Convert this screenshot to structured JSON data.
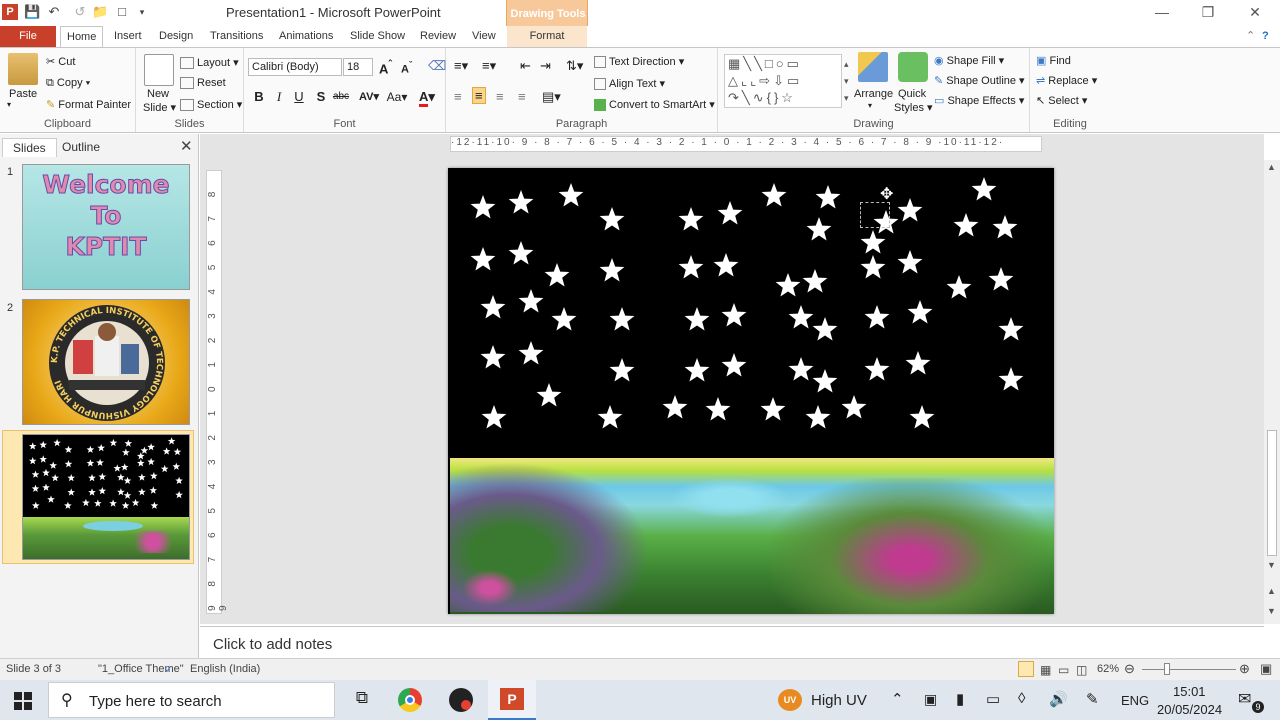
{
  "titlebar": {
    "title": "Presentation1  -  Microsoft PowerPoint",
    "context_tools": "Drawing Tools",
    "context_tab": "Format"
  },
  "tabs": {
    "file": "File",
    "items": [
      "Home",
      "Insert",
      "Design",
      "Transitions",
      "Animations",
      "Slide Show",
      "Review",
      "View"
    ]
  },
  "ribbon": {
    "clipboard": {
      "paste": "Paste",
      "cut": "Cut",
      "copy": "Copy",
      "format_painter": "Format Painter",
      "label": "Clipboard"
    },
    "slides": {
      "new_slide_1": "New",
      "new_slide_2": "Slide",
      "layout": "Layout",
      "reset": "Reset",
      "section": "Section",
      "label": "Slides"
    },
    "font": {
      "name": "Calibri (Body)",
      "size": "18",
      "label": "Font"
    },
    "paragraph": {
      "text_direction": "Text Direction",
      "align_text": "Align Text",
      "smartart": "Convert to SmartArt",
      "label": "Paragraph"
    },
    "drawing": {
      "arrange": "Arrange",
      "quick_styles_1": "Quick",
      "quick_styles_2": "Styles",
      "shape_fill": "Shape Fill",
      "shape_outline": "Shape Outline",
      "shape_effects": "Shape Effects",
      "label": "Drawing"
    },
    "editing": {
      "find": "Find",
      "replace": "Replace",
      "select": "Select",
      "label": "Editing"
    }
  },
  "leftpanel": {
    "tab_slides": "Slides",
    "tab_outline": "Outline",
    "thumbs": [
      {
        "num": "1",
        "lines": [
          "Welcome",
          "To",
          "KPTIT"
        ]
      },
      {
        "num": "2",
        "ring_text": "K.P. TECHNICAL INSTITUTE OF TECHNOLOGY VISHUNPUR HARI"
      },
      {
        "num": "3"
      }
    ]
  },
  "ruler": {
    "h_text": "·12·11·10· 9 · 8 · 7 · 6 · 5 · 4 · 3 · 2 · 1 · 0 · 1 · 2 · 3 · 4 · 5 · 6 · 7 · 8 · 9 ·10·11·12·",
    "v_text": "9 8 7 6 5 4 3 2 1 0 1 2 3 4 5 6 7 8 9"
  },
  "notes": {
    "placeholder": "Click to add notes"
  },
  "status": {
    "slide": "Slide 3 of 3",
    "theme": "\"1_Office Theme\"",
    "language": "English (India)",
    "zoom": "62%"
  },
  "taskbar": {
    "search": "Type here to search",
    "weather": "High UV",
    "lang": "ENG",
    "time": "15:01",
    "date": "20/05/2024",
    "notif_count": "9"
  },
  "colors": {
    "file_tab": "#c8402a",
    "context_tab": "#f7c99a",
    "slide_bg": "#000000"
  }
}
